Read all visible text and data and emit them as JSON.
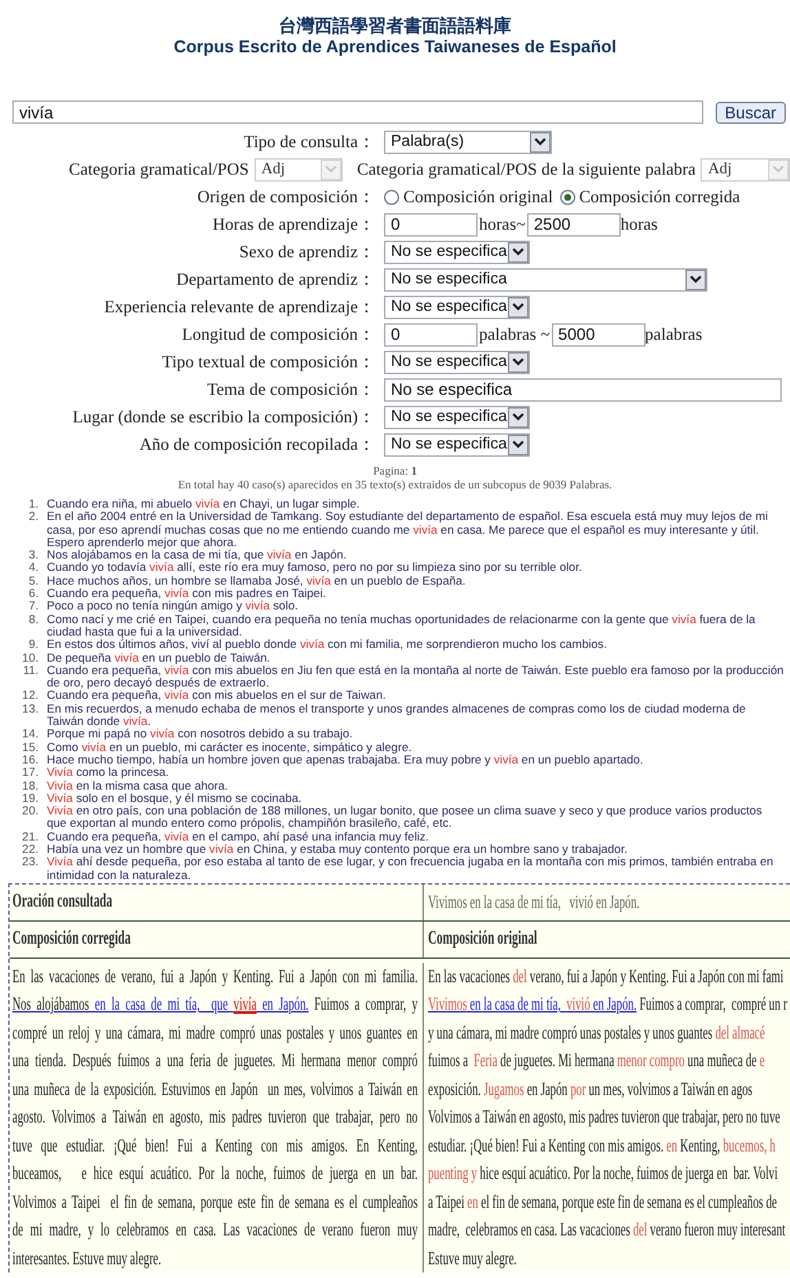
{
  "title_zh": "台灣西語學習者書面語語料庫",
  "title_es": "Corpus Escrito de Aprendices Taiwaneses de Español",
  "search": {
    "value": "vivía",
    "button": "Buscar"
  },
  "form": [
    {
      "label": "Tipo de consulta：",
      "kind": "select",
      "value": "Palabra(s)"
    },
    {
      "kind": "pos_pair",
      "fields": [
        {
          "label": "Categoria gramatical/POS",
          "value": "Adj",
          "disabled": true
        },
        {
          "label": "Categoria gramatical/POS de la siguiente palabra",
          "value": "Adj",
          "disabled": true
        }
      ]
    },
    {
      "label": "Origen de composición：",
      "kind": "radio",
      "options": [
        {
          "label": "Composición original",
          "selected": false
        },
        {
          "label": "Composición corregida",
          "selected": true
        }
      ]
    },
    {
      "label": "Horas de aprendizaje：",
      "kind": "range",
      "from": "0",
      "middle": "horas~",
      "to": "2500",
      "unit": "horas"
    },
    {
      "label": "Sexo de aprendiz：",
      "kind": "select",
      "value": "No se especifica"
    },
    {
      "label": "Departamento de aprendiz：",
      "kind": "select",
      "value": "No se especifica"
    },
    {
      "label": "Experiencia relevante de aprendizaje：",
      "kind": "select",
      "value": "No se especifica"
    },
    {
      "label": "Longitud de composición：",
      "kind": "range",
      "from": "0",
      "middle": "palabras ~",
      "to": "5000",
      "unit": "palabras"
    },
    {
      "label": "Tipo textual de composición：",
      "kind": "select",
      "value": "No se especifica"
    },
    {
      "label": "Tema de composición：",
      "kind": "text",
      "value": "No se especifica"
    },
    {
      "label": "Lugar (donde se escribio la composición)：",
      "kind": "select",
      "value": "No se especifica"
    },
    {
      "label": "Año de composición recopilada：",
      "kind": "select",
      "value": "No se especifica"
    }
  ],
  "page": "Pagina: **1**",
  "summary": "En total hay 40 caso(s) aparecidos en 35 texto(s) extraidos de un subcopus de 9039 Palabras.",
  "results": [
    {
      "num": "1.",
      "before": "Cuando era niña, mi abuelo ",
      "hit": "vivía",
      "after": " en Chayi, un lugar simple."
    },
    {
      "num": "2.",
      "before": "En el año 2004 entré en la Universidad de Tamkang. Soy estudiante del departamento de español. Esa escuela está muy muy lejos de mi casa, por eso aprendí muchas cosas que no me entiendo cuando me ",
      "hit": "vivía",
      "after": " en casa. Me parece que el español es muy interesante y útil. Espero aprenderlo mejor que ahora."
    },
    {
      "num": "3.",
      "before": "Nos alojábamos en la casa de mi tía, que ",
      "hit": "vivía",
      "after": " en Japón."
    },
    {
      "num": "4.",
      "before": "Cuando yo todavía ",
      "hit": "vivía",
      "after": " allí, este río era muy famoso, pero no por su limpieza sino por su terrible olor."
    },
    {
      "num": "5.",
      "before": "Hace muchos años, un hombre se llamaba José, ",
      "hit": "vivía",
      "after": " en un pueblo de España."
    },
    {
      "num": "6.",
      "before": "Cuando era pequeña, ",
      "hit": "vivía",
      "after": " con mis padres en Taipei."
    },
    {
      "num": "7.",
      "before": "Poco a poco no tenía ningún amigo y ",
      "hit": "vivía",
      "after": " solo."
    },
    {
      "num": "8.",
      "before": "Como nací y me crié en Taipei, cuando era pequeña no tenía muchas oportunidades de relacionarme con la gente que ",
      "hit": "vivía",
      "after": " fuera de la ciudad hasta que fui a la universidad."
    },
    {
      "num": "9.",
      "before": "En estos dos últimos años, viví al pueblo donde ",
      "hit": "vivía",
      "after": " con mi familia, me sorprendieron mucho los cambios."
    },
    {
      "num": "10.",
      "before": "De pequeña ",
      "hit": "vivía",
      "after": " en un pueblo de Taiwán."
    },
    {
      "num": "11.",
      "before": "Cuando era pequeña, ",
      "hit": "vivía",
      "after": " con mis abuelos en Jiu fen que está en la montaña al norte de Taiwán. Este pueblo era famoso por la producción de oro, pero decayó después de extraerlo."
    },
    {
      "num": "12.",
      "before": "Cuando era pequeña, ",
      "hit": "vivía",
      "after": " con mis abuelos en el sur de Taiwan."
    },
    {
      "num": "13.",
      "before": "En mis recuerdos, a menudo echaba de menos el transporte y unos grandes almacenes de compras como los de ciudad moderna de Taiwán donde ",
      "hit": "vivía",
      "after": "."
    },
    {
      "num": "14.",
      "before": "Porque mi papá no ",
      "hit": "vivía",
      "after": " con nosotros debido a su trabajo."
    },
    {
      "num": "15.",
      "before": "Como ",
      "hit": "vivía",
      "after": " en un pueblo, mi carácter es inocente, simpático y alegre."
    },
    {
      "num": "16.",
      "before": "Hace mucho tiempo, había un hombre joven que apenas trabajaba. Era muy pobre y ",
      "hit": "vivía",
      "after": " en un pueblo apartado."
    },
    {
      "num": "17.",
      "hit": "Vivía",
      "after": " como la princesa."
    },
    {
      "num": "18.",
      "hit": "Vivía",
      "after": " en la misma casa que ahora."
    },
    {
      "num": "19.",
      "hit": "Vivía",
      "after": " solo en el bosque, y él mismo se cocinaba."
    },
    {
      "num": "20.",
      "hit": "Vivía",
      "after": " en otro país, con una población de 188 millones, un lugar bonito, que posee un clima suave y seco y que produce varios productos que exportan al mundo entero como própolis, champiñón brasileño, café, etc."
    },
    {
      "num": "21.",
      "before": "Cuando era pequeña, ",
      "hit": "vivía",
      "after": " en el campo, ahí pasé una infancia muy feliz."
    },
    {
      "num": "22.",
      "before": "Había una vez un hombre que ",
      "hit": "vivía",
      "after": " en China, y estaba muy contento porque era un hombre sano y trabajador."
    },
    {
      "num": "23.",
      "hit": "Vivía",
      "after": " ahí desde pequeña, por eso estaba al tanto de ese lugar, y con frecuencia jugaba en la montaña con mis primos, también entraba en intimidad con la naturaleza."
    }
  ],
  "comparison": {
    "query_label": "Oración consultada",
    "query": "Vivimos en la casa de mi tía,   vivió en Japón.",
    "corrected_heading": "Composición corregida",
    "original_heading": "Composición original",
    "corrected_lines": [
      [
        {
          "text": "En las vacaciones de verano, fui a Japón y Kenting. Fui a Japón con mi familia.",
          "kind": "plain"
        }
      ],
      [
        {
          "text": "Nos alojábamos ",
          "kind": "sentence"
        },
        {
          "text": "en la casa de mi tía,  que ",
          "kind": "link"
        },
        {
          "text": "vivía",
          "kind": "hit"
        },
        {
          "text": " en Japón.",
          "kind": "link"
        },
        {
          "text": " Fuimos a comprar, y",
          "kind": "plain"
        }
      ],
      [
        {
          "text": "compré un reloj y una cámara, mi madre compró unas postales y unos guantes en",
          "kind": "plain"
        }
      ],
      [
        {
          "text": "una tienda. Después fuimos a una feria de juguetes. Mi hermana menor compró",
          "kind": "plain"
        }
      ],
      [
        {
          "text": "una muñeca de la exposición. Estuvimos en Japón  un mes, volvimos a Taiwán en",
          "kind": "plain"
        }
      ],
      [
        {
          "text": "agosto. Volvimos a Taiwán en agosto, mis padres tuvieron que trabajar, pero no",
          "kind": "plain"
        }
      ],
      [
        {
          "text": "tuve que estudiar. ¡Qué bien! Fui a Kenting con mis amigos. En Kenting,",
          "kind": "plain"
        }
      ],
      [
        {
          "text": "buceamos,   e hice esquí acuático. Por la noche, fuimos de juerga en un bar.",
          "kind": "plain"
        }
      ],
      [
        {
          "text": "Volvimos a Taipei  el fin de semana, porque este fin de semana es el cumpleaños",
          "kind": "plain"
        }
      ],
      [
        {
          "text": "de mi madre, y lo celebramos en casa. Las vacaciones de verano fueron muy",
          "kind": "plain"
        }
      ],
      [
        {
          "text": "interesantes. Estuve muy alegre.",
          "kind": "plain"
        }
      ]
    ],
    "original_lines": [
      [
        {
          "text": "En las vacaciones ",
          "kind": "plain"
        },
        {
          "text": "del",
          "kind": "error"
        },
        {
          "text": " verano, fui a Japón y Kenting. Fui a Japón con mi fami",
          "kind": "plain"
        }
      ],
      [
        {
          "text": "Vivimos",
          "kind": "error_sentence"
        },
        {
          "text": " en la casa de mi tía,  ",
          "kind": "link"
        },
        {
          "text": "vivió",
          "kind": "error_sentence"
        },
        {
          "text": " en Japón.",
          "kind": "link"
        },
        {
          "text": " Fuimos a comprar,  compré un r",
          "kind": "plain"
        }
      ],
      [
        {
          "text": "y una cámara, mi madre compró unas postales y unos guantes ",
          "kind": "plain"
        },
        {
          "text": "del almacé",
          "kind": "error"
        }
      ],
      [
        {
          "text": "fuimos a  ",
          "kind": "plain"
        },
        {
          "text": "Feria",
          "kind": "error"
        },
        {
          "text": " de juguetes. Mi hermana ",
          "kind": "plain"
        },
        {
          "text": "menor compro",
          "kind": "error"
        },
        {
          "text": " una muñeca de ",
          "kind": "plain"
        },
        {
          "text": "e",
          "kind": "error"
        }
      ],
      [
        {
          "text": "exposición. ",
          "kind": "plain"
        },
        {
          "text": "Jugamos",
          "kind": "error"
        },
        {
          "text": " en Japón ",
          "kind": "plain"
        },
        {
          "text": "por",
          "kind": "error"
        },
        {
          "text": " un mes, volvimos a Taiwán en agos",
          "kind": "plain"
        }
      ],
      [
        {
          "text": "Volvimos a Taiwán en agosto, mis padres tuvieron que trabajar, pero no tuve",
          "kind": "plain"
        }
      ],
      [
        {
          "text": "estudiar. ¡Qué bien! Fui a Kenting con mis amigos. ",
          "kind": "plain"
        },
        {
          "text": "en",
          "kind": "error"
        },
        {
          "text": " Kenting, ",
          "kind": "plain"
        },
        {
          "text": "bucemos, h",
          "kind": "error"
        }
      ],
      [
        {
          "text": "puenting y",
          "kind": "error"
        },
        {
          "text": " hice esquí acuático. Por la noche, fuimos de juerga en  bar. Volvi",
          "kind": "plain"
        }
      ],
      [
        {
          "text": "a Taipei ",
          "kind": "plain"
        },
        {
          "text": "en",
          "kind": "error"
        },
        {
          "text": " el fin de semana, porque este fin de semana es el cumpleaños de",
          "kind": "plain"
        }
      ],
      [
        {
          "text": "madre,  celebramos en casa. Las vacaciones ",
          "kind": "plain"
        },
        {
          "text": "del",
          "kind": "error"
        },
        {
          "text": " verano fueron muy interesant",
          "kind": "plain"
        }
      ],
      [
        {
          "text": "Estuve muy alegre.",
          "kind": "plain"
        }
      ]
    ]
  }
}
